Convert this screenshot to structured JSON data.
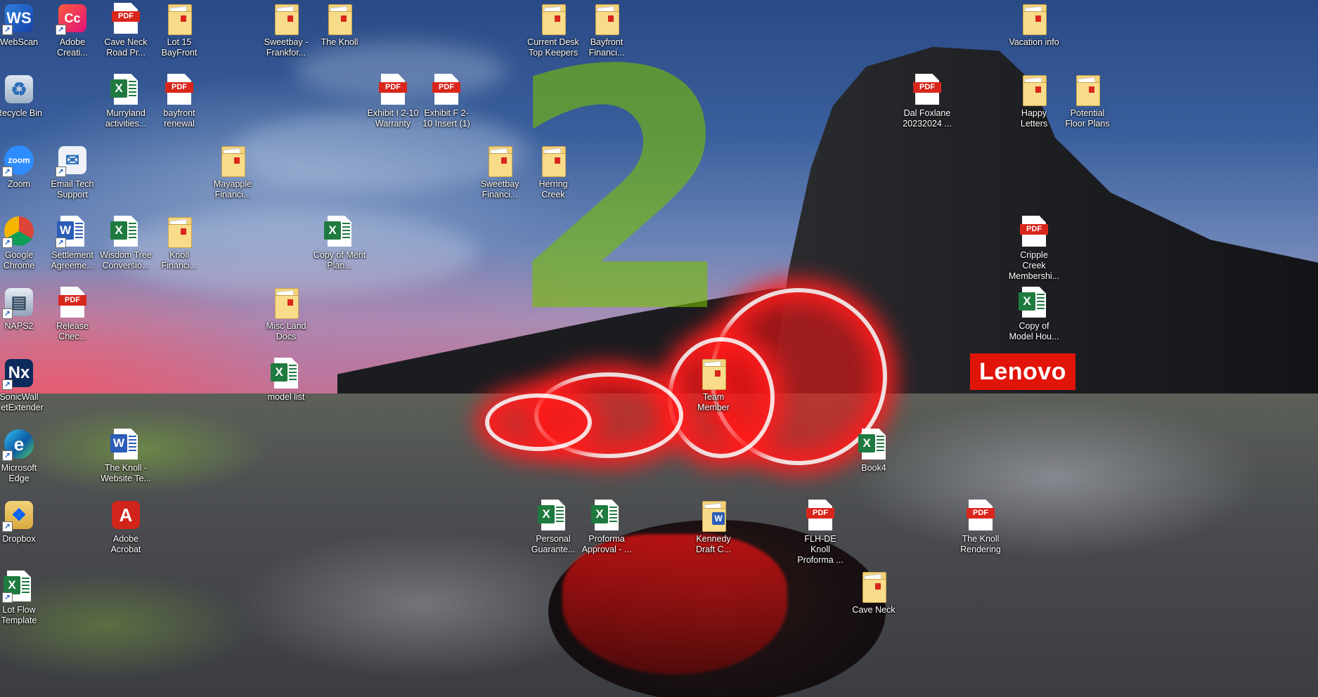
{
  "desktop": {
    "icons": [
      {
        "label": "WebScan",
        "type": "app",
        "app": "webscan",
        "glyph": "WS",
        "shortcut": true
      },
      {
        "label": "Adobe Creati...",
        "type": "app",
        "app": "creative-cloud",
        "glyph": "Cc",
        "shortcut": true
      },
      {
        "label": "Cave Neck Road Pr...",
        "type": "pdf",
        "tag": "PDF"
      },
      {
        "label": "Lot 15 BayFront",
        "type": "folder"
      },
      {
        "label": "Sweetbay - Frankfor...",
        "type": "folder"
      },
      {
        "label": "The Knoll",
        "type": "folder"
      },
      {
        "label": "Current Desk Top Keepers",
        "type": "folder"
      },
      {
        "label": "Bayfront Financi...",
        "type": "folder"
      },
      {
        "label": "Vacation info",
        "type": "folder"
      },
      {
        "label": "Recycle Bin",
        "type": "app",
        "app": "recycle-bin",
        "glyph": "♻",
        "shortcut": false
      },
      {
        "label": "Murryland activities...",
        "type": "excel",
        "tag": "X"
      },
      {
        "label": "bayfront renewal",
        "type": "pdf",
        "tag": "PDF"
      },
      {
        "label": "Exhibit I 2-10 Warranty",
        "type": "pdf",
        "tag": "PDF"
      },
      {
        "label": "Exhibit F 2-10 Insert (1)",
        "type": "pdf",
        "tag": "PDF"
      },
      {
        "label": "Dal Foxlane 20232024 ...",
        "type": "pdf",
        "tag": "PDF"
      },
      {
        "label": "Happy Letters",
        "type": "folder"
      },
      {
        "label": "Potential Floor Plans",
        "type": "folder"
      },
      {
        "label": "Zoom",
        "type": "app",
        "app": "zoom",
        "glyph": "zoom",
        "shortcut": true
      },
      {
        "label": "Email Tech Support",
        "type": "app",
        "app": "email",
        "glyph": "✉",
        "shortcut": true
      },
      {
        "label": "Mayapple Financi...",
        "type": "folder"
      },
      {
        "label": "Sweetbay Financi...",
        "type": "folder"
      },
      {
        "label": "Herring Creek",
        "type": "folder"
      },
      {
        "label": "Google Chrome",
        "type": "app",
        "app": "chrome",
        "glyph": "",
        "shortcut": true
      },
      {
        "label": "Settlement Agreeme...",
        "type": "word",
        "tag": "W",
        "shortcut": true
      },
      {
        "label": "Wisdom Tree Conversio...",
        "type": "excel",
        "tag": "X"
      },
      {
        "label": "Knoll Financi...",
        "type": "folder"
      },
      {
        "label": "Copy of Merit Plan...",
        "type": "excel",
        "tag": "X"
      },
      {
        "label": "Cripple Creek Membershi...",
        "type": "pdf",
        "tag": "PDF"
      },
      {
        "label": "NAPS2",
        "type": "app",
        "app": "naps2",
        "glyph": "▤",
        "shortcut": true
      },
      {
        "label": "Release Chec...",
        "type": "pdf",
        "tag": "PDF"
      },
      {
        "label": "Misc Land Docs",
        "type": "folder"
      },
      {
        "label": "Copy of Model Hou...",
        "type": "excel",
        "tag": "X"
      },
      {
        "label": "SonicWall NetExtender",
        "type": "app",
        "app": "netextender",
        "glyph": "Nx",
        "shortcut": true
      },
      {
        "label": "model list",
        "type": "excel",
        "tag": "X"
      },
      {
        "label": "Team Member",
        "type": "folder"
      },
      {
        "label": "Microsoft Edge",
        "type": "app",
        "app": "edge",
        "glyph": "e",
        "shortcut": true
      },
      {
        "label": "The Knoll - Website Te...",
        "type": "word",
        "tag": "W"
      },
      {
        "label": "Book4",
        "type": "excel",
        "tag": "X"
      },
      {
        "label": "Dropbox",
        "type": "app",
        "app": "dropbox",
        "glyph": "❖",
        "shortcut": true
      },
      {
        "label": "Adobe Acrobat",
        "type": "app",
        "app": "acrobat",
        "glyph": "A",
        "shortcut": false
      },
      {
        "label": "Personal Guarante...",
        "type": "excel",
        "tag": "X"
      },
      {
        "label": "Proforma Approval - ...",
        "type": "excel",
        "tag": "X"
      },
      {
        "label": "Kennedy Draft C...",
        "type": "word-folder",
        "tag": "W"
      },
      {
        "label": "FLH-DE Knoll Proforma ...",
        "type": "pdf",
        "tag": "PDF"
      },
      {
        "label": "The Knoll Rendering",
        "type": "pdf",
        "tag": "PDF"
      },
      {
        "label": "Lot Flow Template",
        "type": "excel",
        "tag": "X",
        "shortcut": true
      },
      {
        "label": "Cave Neck",
        "type": "folder"
      }
    ]
  },
  "wallpaper": {
    "numeral": "2",
    "brand": "Lenovo",
    "colors": {
      "sky_top": "#2a4a86",
      "sunset": "#d2667f",
      "numeral": "#78be00",
      "light_ring": "#ff1e1e",
      "brand_red": "#e1140a"
    }
  }
}
